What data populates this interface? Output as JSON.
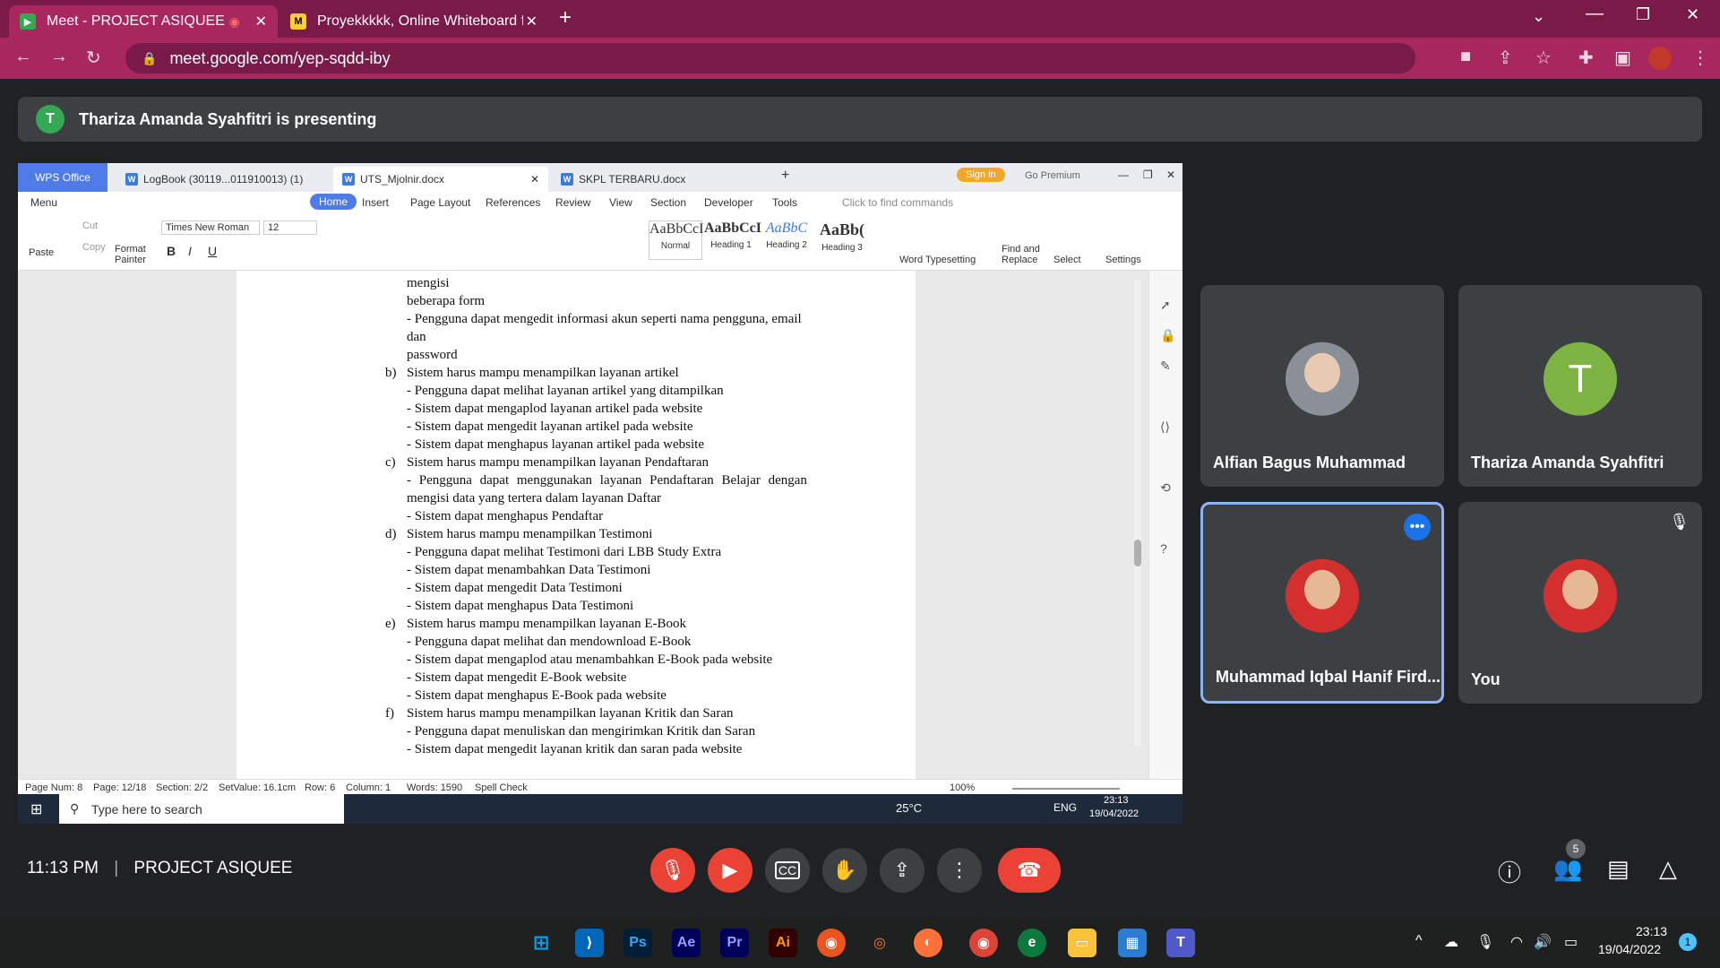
{
  "browser": {
    "tabs": [
      {
        "title": "Meet - PROJECT ASIQUEE",
        "favicon": "meet-icon"
      },
      {
        "title": "Proyekkkkk, Online Whiteboard f",
        "favicon": "miro-icon"
      }
    ],
    "url": "meet.google.com/yep-sqdd-iby"
  },
  "banner": {
    "avatar_letter": "T",
    "text": "Thariza Amanda Syahfitri is presenting"
  },
  "wps": {
    "app_tab": "WPS Office",
    "doc_tabs": [
      "LogBook (30119...011910013) (1)",
      "UTS_Mjolnir.docx",
      "SKPL TERBARU.docx"
    ],
    "sign_in": "Sign in",
    "go_premium": "Go Premium",
    "menu": [
      "Menu",
      "Home",
      "Insert",
      "Page Layout",
      "References",
      "Review",
      "View",
      "Section",
      "Developer",
      "Tools"
    ],
    "find_commands": "Click to find commands",
    "font_name": "Times New Roman",
    "font_size": "12",
    "styles": [
      {
        "preview": "AaBbCcI",
        "name": "Normal"
      },
      {
        "preview": "AaBbCcI",
        "name": "Heading 1"
      },
      {
        "preview": "AaBbC",
        "name": "Heading 2"
      },
      {
        "preview": "AaBb(",
        "name": "Heading 3"
      }
    ],
    "ribbon_labels": {
      "paste": "Paste",
      "cut": "Cut",
      "copy": "Copy",
      "format_painter_1": "Format",
      "format_painter_2": "Painter",
      "word_typesetting": "Word Typesetting",
      "find_replace_1": "Find and",
      "find_replace_2": "Replace",
      "select": "Select",
      "settings": "Settings"
    },
    "document_lines": [
      "mengisi",
      "beberapa form",
      "- Pengguna dapat mengedit informasi akun seperti nama pengguna, email",
      "dan",
      "password",
      "b)",
      "Sistem harus mampu menampilkan layanan artikel",
      "- Pengguna dapat melihat layanan artikel yang ditampilkan",
      "- Sistem dapat mengaplod layanan artikel pada website",
      "- Sistem dapat mengedit layanan artikel pada website",
      "- Sistem dapat menghapus layanan artikel pada website",
      "c)",
      "Sistem harus mampu menampilkan layanan Pendaftaran",
      "- Pengguna dapat menggunakan layanan Pendaftaran Belajar dengan",
      "mengisi data yang tertera dalam layanan Daftar",
      "- Sistem dapat menghapus Pendaftar",
      "d)",
      "Sistem harus mampu menampilkan Testimoni",
      "- Pengguna dapat melihat Testimoni dari LBB Study Extra",
      "- Sistem dapat menambahkan Data Testimoni",
      "- Sistem dapat mengedit Data Testimoni",
      "- Sistem dapat menghapus Data Testimoni",
      "e)",
      "Sistem harus mampu menampilkan layanan E-Book",
      "- Pengguna dapat melihat dan mendownload E-Book",
      "- Sistem dapat mengaplod atau menambahkan E-Book pada website",
      "- Sistem dapat mengedit E-Book website",
      "- Sistem dapat menghapus E-Book pada website",
      "f)",
      "Sistem harus mampu menampilkan layanan Kritik dan Saran",
      "- Pengguna dapat menuliskan dan mengirimkan Kritik dan Saran",
      "- Sistem dapat mengedit layanan kritik dan saran pada website"
    ],
    "status": {
      "page_num": "Page Num: 8",
      "page": "Page: 12/18",
      "section": "Section: 2/2",
      "setvalue": "SetValue: 16.1cm",
      "row": "Row: 6",
      "column": "Column: 1",
      "words": "Words: 1590",
      "spell": "Spell Check",
      "zoom": "100%"
    },
    "taskbar": {
      "search": "Type here to search",
      "weather": "25°C",
      "lang": "ENG",
      "time": "23:13",
      "date": "19/04/2022"
    }
  },
  "participants": [
    {
      "name": "Alfian Bagus Muhammad"
    },
    {
      "name": "Thariza Amanda Syahfitri",
      "letter": "T"
    },
    {
      "name": "Muhammad Iqbal Hanif Fird..."
    },
    {
      "name": "You"
    }
  ],
  "meet": {
    "time": "11:13 PM",
    "separator": "|",
    "meeting_name": "PROJECT ASIQUEE",
    "people_count": "5"
  },
  "win11": {
    "time": "23:13",
    "date": "19/04/2022",
    "notif": "1"
  }
}
